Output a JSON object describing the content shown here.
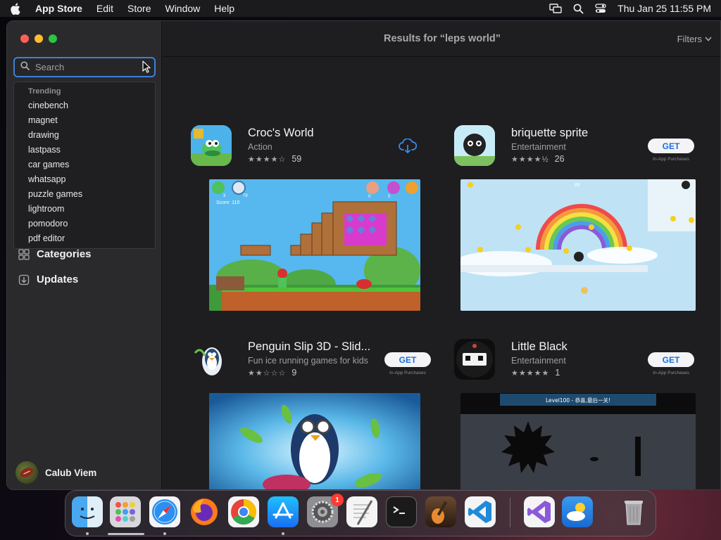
{
  "menubar": {
    "app_name": "App Store",
    "items": [
      "Edit",
      "Store",
      "Window",
      "Help"
    ],
    "datetime": "Thu Jan 25  11:55 PM"
  },
  "sidebar": {
    "search": {
      "placeholder": "Search",
      "value": ""
    },
    "trending": {
      "header": "Trending",
      "items": [
        "cinebench",
        "magnet",
        "drawing",
        "lastpass",
        "car games",
        "whatsapp",
        "puzzle games",
        "lightroom",
        "pomodoro",
        "pdf editor"
      ]
    },
    "nav": {
      "categories": "Categories",
      "updates": "Updates"
    },
    "account_name": "Calub Viem"
  },
  "main": {
    "title": "Results for “leps world”",
    "filters_label": "Filters",
    "apps": [
      {
        "name": "Croc's World",
        "subtitle": "Action",
        "rating": 4,
        "rating_count": "59",
        "action": "download"
      },
      {
        "name": "briquette sprite",
        "subtitle": "Entertainment",
        "rating": 4.5,
        "rating_count": "26",
        "action": "GET",
        "iap": "In-App Purchases"
      },
      {
        "name": "Penguin Slip 3D - Slid...",
        "subtitle": "Fun ice running games for kids",
        "rating": 2,
        "rating_count": "9",
        "action": "GET",
        "iap": "In-App Purchases"
      },
      {
        "name": "Little Black",
        "subtitle": "Entertainment",
        "rating": 5,
        "rating_count": "1",
        "action": "GET",
        "iap": "In-App Purchases"
      }
    ],
    "screenshots": {
      "croc_score": "Score: 110",
      "croc_lives": "3",
      "croc_time": "79",
      "croc_bag": "0",
      "croc_gems": "5",
      "briquette_counter": "89",
      "little_black_banner": "Level100 - 恭喜,最后一关!"
    }
  },
  "dock": {
    "apps": [
      "Finder",
      "Launchpad",
      "Safari",
      "Firefox",
      "Chrome",
      "App Store",
      "System Settings",
      "TextEdit",
      "Terminal",
      "GarageBand",
      "Visual Studio Code",
      "Visual Studio",
      "Weather",
      "Trash"
    ],
    "settings_badge": "1"
  },
  "colors": {
    "accent": "#3f7fd8",
    "get_text": "#1a6fe0",
    "badge": "#ff3b30"
  }
}
